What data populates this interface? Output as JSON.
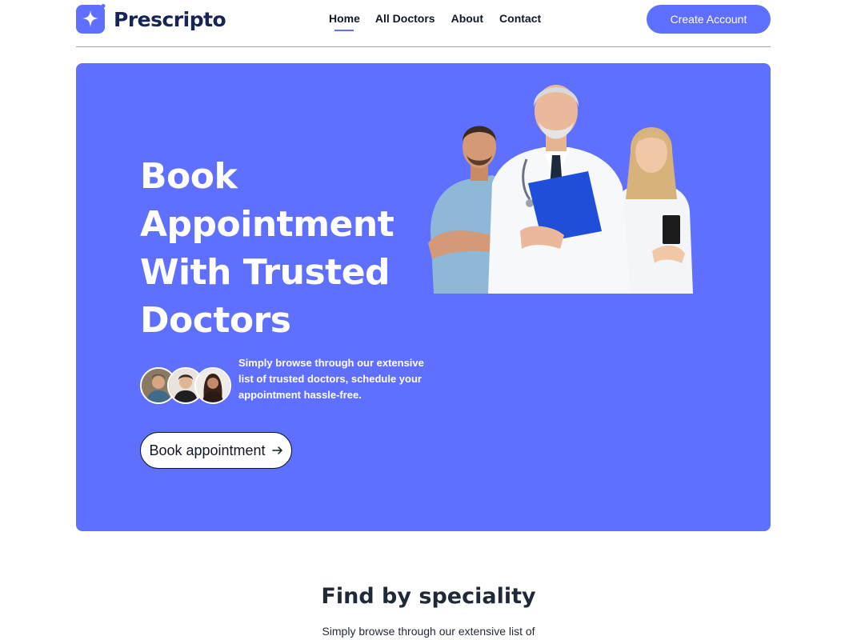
{
  "brand": {
    "name": "Prescripto",
    "color": "#5f6fff"
  },
  "nav": {
    "links": [
      {
        "label": "Home",
        "active": true
      },
      {
        "label": "All Doctors",
        "active": false
      },
      {
        "label": "About",
        "active": false
      },
      {
        "label": "Contact",
        "active": false
      }
    ],
    "cta_label": "Create Account"
  },
  "hero": {
    "title": "Book Appointment With Trusted Doctors",
    "description": "Simply browse through our extensive list of trusted doctors, schedule your appointment hassle-free.",
    "button_label": "Book appointment",
    "button_icon": "arrow-right-icon",
    "background": "#5f6fff"
  },
  "speciality": {
    "title": "Find by speciality",
    "subtitle": "Simply browse through our extensive list of"
  }
}
